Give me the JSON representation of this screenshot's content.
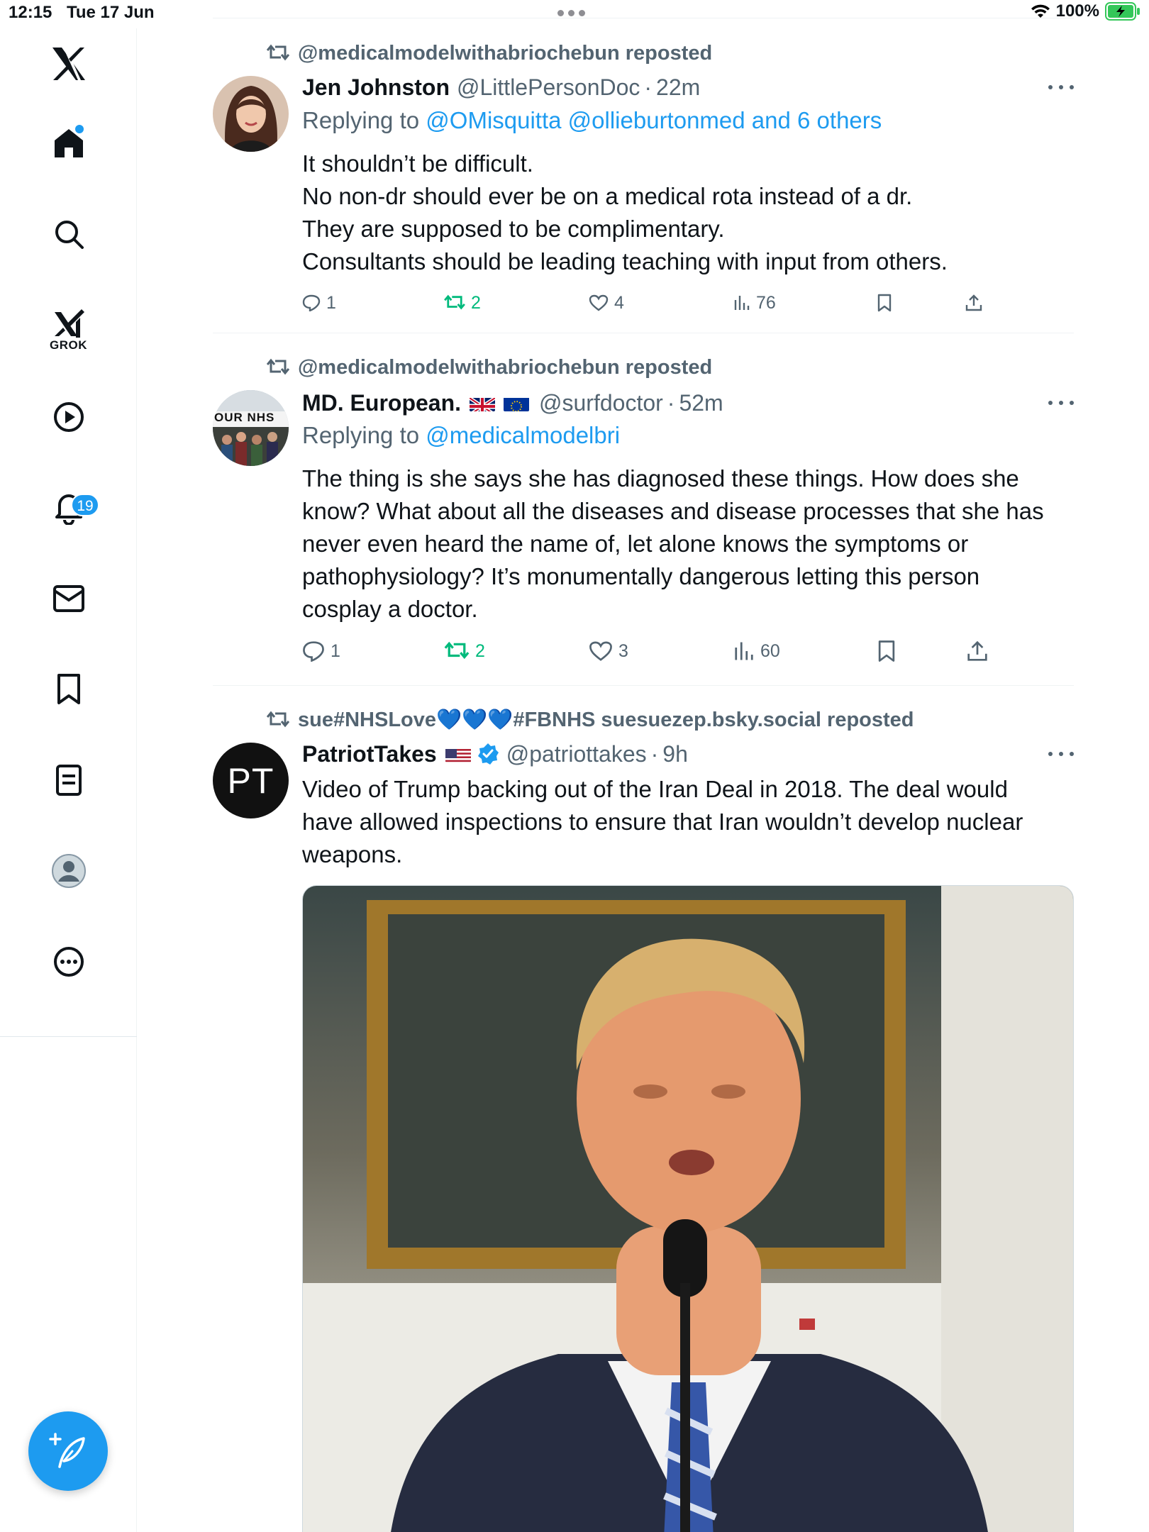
{
  "status_bar": {
    "time": "12:15",
    "date": "Tue 17 Jun",
    "battery": "100%"
  },
  "sidebar": {
    "notifications_count": "19",
    "grok_label": "GROK"
  },
  "colors": {
    "accent": "#1d9bf0",
    "secondary_text": "#536471",
    "repost_green": "#00ba7c"
  },
  "tweets": [
    {
      "repost_by": "@medicalmodelwithabriochebun reposted",
      "name": "Jen Johnston",
      "handle": "@LittlePersonDoc",
      "sep": "·",
      "time": "22m",
      "replying_prefix": "Replying to",
      "replying_links": "@OMisquitta @ollieburtonmed and 6 others",
      "body": [
        "It shouldn’t be difficult.",
        "No non-dr should ever be on a medical rota instead of a dr.",
        "They are supposed to be complimentary.",
        "Consultants should be leading teaching with input from others."
      ],
      "replies": "1",
      "reposts": "2",
      "likes": "4",
      "views": "76"
    },
    {
      "repost_by": "@medicalmodelwithabriochebun reposted",
      "name": "MD. European.",
      "handle": "@surfdoctor",
      "sep": "·",
      "time": "52m",
      "avatar_text": "OUR NHS",
      "replying_prefix": "Replying to",
      "replying_links": "@medicalmodelbri",
      "body": [
        "The thing is she says she has diagnosed these things. How does she",
        "know? What about all the diseases and disease processes that she has",
        "never even heard the name of, let alone knows the symptoms or",
        "pathophysiology? It’s monumentally dangerous letting this person",
        "cosplay a doctor."
      ],
      "replies": "1",
      "reposts": "2",
      "likes": "3",
      "views": "60"
    },
    {
      "repost_by": "sue#NHSLove💙💙💙#FBNHS suesuezep.bsky.social reposted",
      "name": "PatriotTakes",
      "handle": "@patriottakes",
      "sep": "·",
      "time": "9h",
      "avatar_text": "PT",
      "body": [
        "Video of Trump backing out of the Iran Deal in 2018. The deal would",
        "have allowed inspections to ensure that Iran wouldn’t develop nuclear",
        "weapons."
      ]
    }
  ]
}
